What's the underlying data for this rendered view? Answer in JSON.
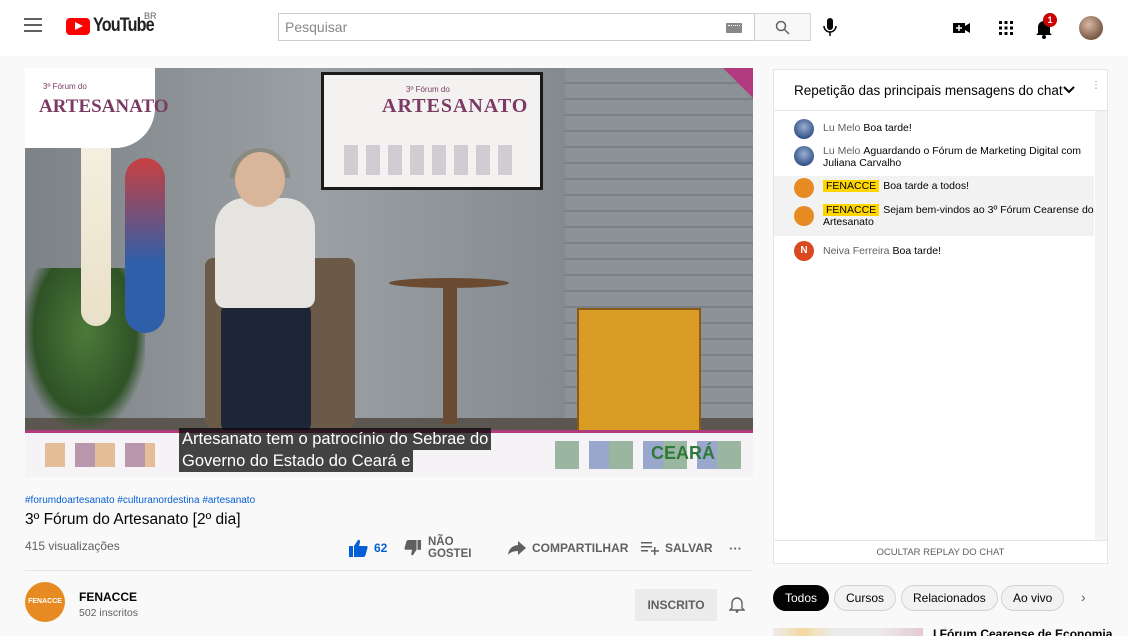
{
  "header": {
    "logo_text": "YouTube",
    "region": "BR",
    "search_placeholder": "Pesquisar",
    "notification_count": "1"
  },
  "video": {
    "screen_subtitle": "3º Fórum do",
    "screen_title": "ARTESANATO",
    "overlay_subtitle": "3º Fórum do",
    "overlay_title": "ARTESANATO",
    "banner_brand": "CEARÁ",
    "caption_line1": "Artesanato tem o patrocínio do Sebrae do",
    "caption_line2": "Governo do Estado do Ceará e"
  },
  "meta": {
    "hashtags": "#forumdoartesanato #culturanordestina #artesanato",
    "title": "3º Fórum do Artesanato [2º dia]",
    "views": "415 visualizações",
    "like_count": "62",
    "dislike_line1": "NÃO",
    "dislike_line2": "GOSTEI",
    "share_label": "COMPARTILHAR",
    "save_label": "SALVAR",
    "more_label": "···"
  },
  "channel": {
    "avatar_text": "FENACCE",
    "name": "FENACCE",
    "subscribers": "502 inscritos",
    "subscribe_label": "INSCRITO"
  },
  "chat": {
    "header_title": "Repetição das principais mensagens do chat",
    "footer_label": "OCULTAR REPLAY DO CHAT",
    "messages": [
      {
        "author": "Lu Melo",
        "text": "Boa tarde!",
        "owner": false,
        "initial": ""
      },
      {
        "author": "Lu Melo",
        "text": "Aguardando o Fórum de Marketing Digital com Juliana Carvalho",
        "owner": false,
        "initial": ""
      },
      {
        "author": "FENACCE",
        "text": "Boa tarde a todos!",
        "owner": true,
        "initial": ""
      },
      {
        "author": "FENACCE",
        "text": "Sejam bem-vindos ao 3º Fórum Cearense do Artesanato",
        "owner": true,
        "initial": ""
      },
      {
        "author": "Neiva Ferreira",
        "text": "Boa tarde!",
        "owner": false,
        "initial": "N"
      }
    ]
  },
  "chips": [
    "Todos",
    "Cursos",
    "Relacionados",
    "Ao vivo"
  ],
  "chip_next": "›",
  "next_video": {
    "title": "I Fórum Cearense de Economia"
  },
  "colors": {
    "brand_red": "#ff0000",
    "link_blue": "#065fd4",
    "owner_badge": "#ffd600",
    "fenacce_orange": "#e88a22",
    "neiva_red": "#d9481f"
  }
}
